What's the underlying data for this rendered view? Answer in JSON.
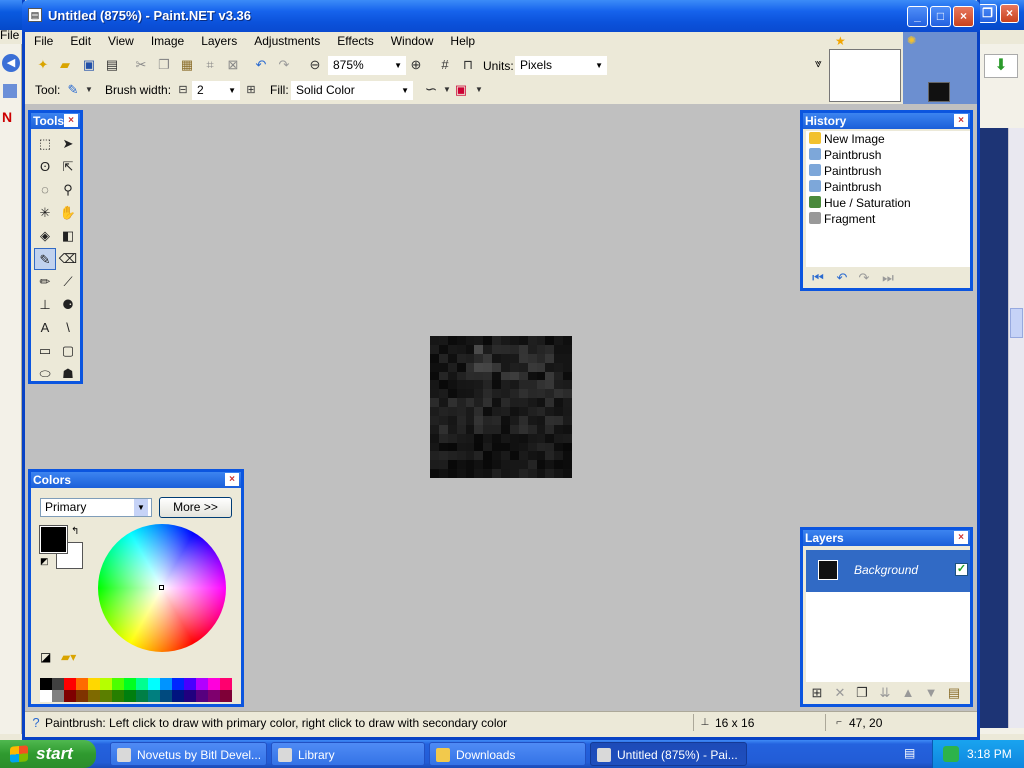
{
  "background_window": {
    "menu_label": "File"
  },
  "window": {
    "title": "Untitled (875%) - Paint.NET v3.36",
    "minimize": "_",
    "maximize": "□",
    "close": "×"
  },
  "menu": [
    "File",
    "Edit",
    "View",
    "Image",
    "Layers",
    "Adjustments",
    "Effects",
    "Window",
    "Help"
  ],
  "toolbar": {
    "zoom_value": "875%",
    "units_label": "Units:",
    "units_value": "Pixels",
    "tool_label": "Tool:",
    "brush_width_label": "Brush width:",
    "brush_width_value": "2",
    "fill_label": "Fill:",
    "fill_value": "Solid Color"
  },
  "tools_panel": {
    "title": "Tools",
    "icons": [
      "rectangle-select-icon",
      "move-selection-icon",
      "lasso-select-icon",
      "move-selected-icon",
      "ellipse-select-icon",
      "zoom-icon",
      "magic-wand-icon",
      "pan-icon",
      "paint-bucket-icon",
      "gradient-icon",
      "paintbrush-icon",
      "eraser-icon",
      "pencil-icon",
      "color-picker-icon",
      "clone-stamp-icon",
      "recolor-icon",
      "text-icon",
      "line-curve-icon",
      "rectangle-icon",
      "rounded-rectangle-icon",
      "ellipse-icon",
      "freeform-shape-icon"
    ]
  },
  "history_panel": {
    "title": "History",
    "items": [
      {
        "label": "New Image",
        "color": "#f2c12e"
      },
      {
        "label": "Paintbrush",
        "color": "#7da7d9"
      },
      {
        "label": "Paintbrush",
        "color": "#7da7d9"
      },
      {
        "label": "Paintbrush",
        "color": "#7da7d9"
      },
      {
        "label": "Hue / Saturation",
        "color": "#4a8a3c"
      },
      {
        "label": "Fragment",
        "color": "#999999"
      }
    ]
  },
  "colors_panel": {
    "title": "Colors",
    "mode_value": "Primary",
    "more_button": "More >>",
    "primary_color": "#000000",
    "secondary_color": "#ffffff",
    "palette": [
      "#000000",
      "#404040",
      "#ff0000",
      "#ff6a00",
      "#ffd800",
      "#b6ff00",
      "#4cff00",
      "#00ff21",
      "#00ff90",
      "#00ffff",
      "#0094ff",
      "#0026ff",
      "#4800ff",
      "#b200ff",
      "#ff00dc",
      "#ff006e",
      "#ffffff",
      "#808080",
      "#7f0000",
      "#7f3300",
      "#7f6a00",
      "#5b7f00",
      "#267f00",
      "#007f0e",
      "#007f46",
      "#007f7f",
      "#004a7f",
      "#00137f",
      "#21007f",
      "#57007f",
      "#7f006e",
      "#7f0037"
    ]
  },
  "layers_panel": {
    "title": "Layers",
    "layer_name": "Background",
    "layer_visible": true
  },
  "status": {
    "hint": "Paintbrush: Left click to draw with primary color, right click to draw with secondary color",
    "size": "16 x 16",
    "position": "47, 20"
  },
  "taskbar": {
    "start_label": "start",
    "tasks": [
      {
        "label": "Novetus by Bitl Devel...",
        "active": false
      },
      {
        "label": "Library",
        "active": false
      },
      {
        "label": "Downloads",
        "active": false
      },
      {
        "label": "Untitled (875%) - Pai...",
        "active": true
      }
    ],
    "clock": "3:18 PM"
  }
}
